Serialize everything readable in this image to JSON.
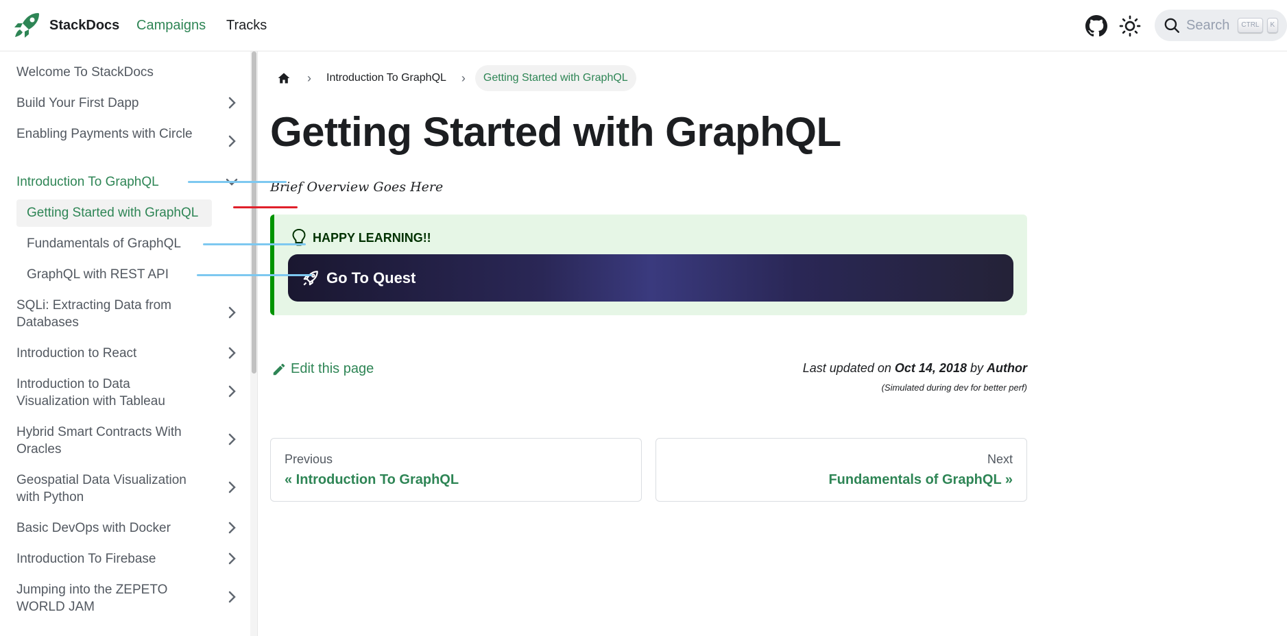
{
  "navbar": {
    "brand": "StackDocs",
    "links": [
      "Campaigns",
      "Tracks"
    ],
    "search_placeholder": "Search",
    "kbd": [
      "CTRL",
      "K"
    ],
    "icons": [
      "rocket-logo-icon",
      "github-icon",
      "sun-icon",
      "search-icon"
    ]
  },
  "sidebar": {
    "items": [
      {
        "label": "Welcome To StackDocs"
      },
      {
        "label": "Build Your First Dapp"
      },
      {
        "label": "Enabling Payments with Circle"
      },
      {
        "label": "Introduction To GraphQL"
      },
      {
        "label": "SQLi: Extracting Data from Databases"
      },
      {
        "label": "Introduction to React"
      },
      {
        "label": "Introduction to Data Visualization with Tableau"
      },
      {
        "label": "Hybrid Smart Contracts With Oracles"
      },
      {
        "label": "Geospatial Data Visualization with Python"
      },
      {
        "label": "Basic DevOps with Docker"
      },
      {
        "label": "Introduction To Firebase"
      },
      {
        "label": "Jumping into the ZEPETO WORLD JAM"
      }
    ],
    "sub_items": [
      {
        "label": "Getting Started with GraphQL",
        "active": true
      },
      {
        "label": "Fundamentals of GraphQL"
      },
      {
        "label": "GraphQL with REST API"
      }
    ]
  },
  "breadcrumb": {
    "items": [
      "Introduction To GraphQL",
      "Getting Started with GraphQL"
    ]
  },
  "page": {
    "title": "Getting Started with GraphQL",
    "subtitle": "Brief Overview Goes Here",
    "admonition": {
      "title": "HAPPY LEARNING!!",
      "button": "Go To Quest"
    },
    "edit_label": "Edit this page",
    "updated": {
      "prefix": "Last updated on",
      "date": "Oct 14, 2018",
      "by": "by",
      "author": "Author",
      "note": "(Simulated during dev for better perf)"
    },
    "pagination": {
      "prev_sub": "Previous",
      "prev_label": "« Introduction To GraphQL",
      "next_sub": "Next",
      "next_label": "Fundamentals of GraphQL »"
    }
  },
  "colors": {
    "accent": "#2e8555",
    "admonition_bg": "#e6f6e6",
    "admonition_border": "#009400",
    "quest_button": "#2a2756",
    "annotation_blue": "#7dc8f0",
    "annotation_red": "#e0202a"
  }
}
